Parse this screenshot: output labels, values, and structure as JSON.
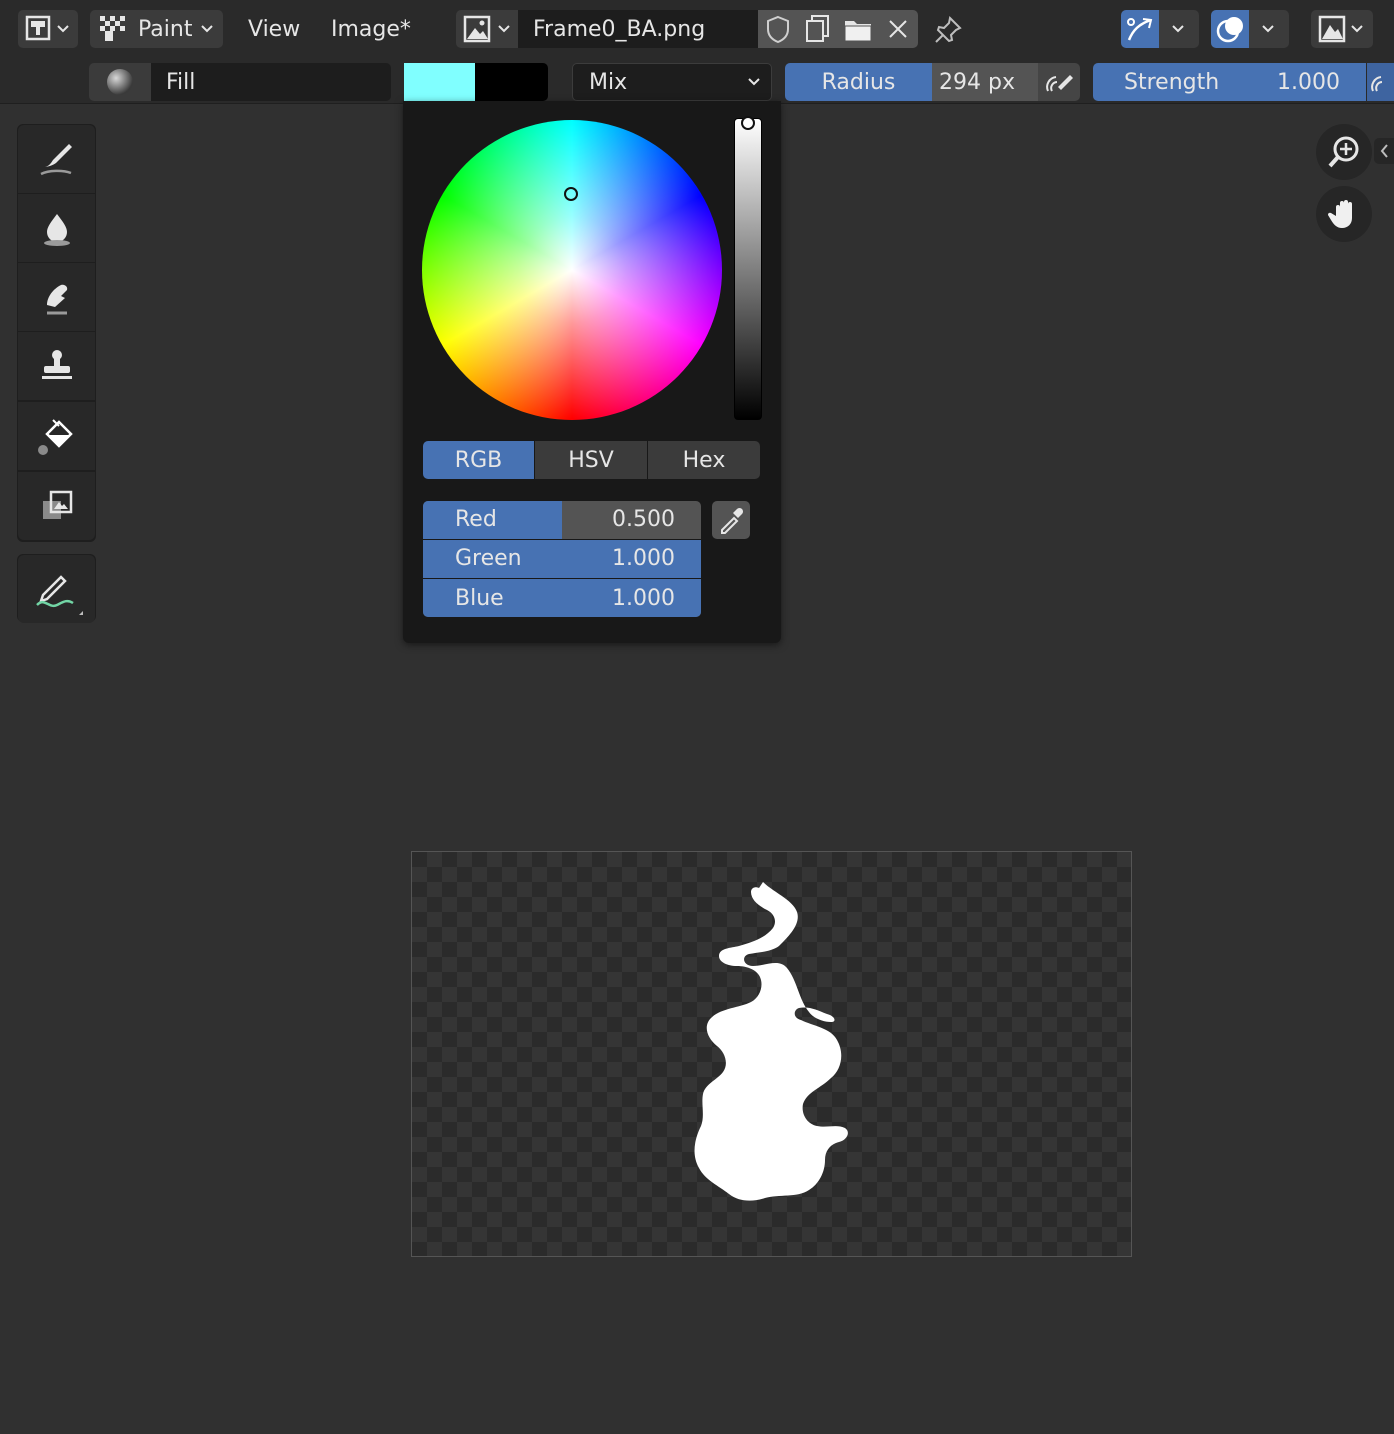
{
  "header": {
    "mode_menu": "Paint",
    "menus": [
      "View",
      "Image*"
    ],
    "image_name": "Frame0_BA.png"
  },
  "toolbar": {
    "brush_name": "Fill",
    "primary_color": "#80ffff",
    "secondary_color": "#000000",
    "blend_mode": "Mix",
    "radius_label": "Radius",
    "radius_value": "294 px",
    "strength_label": "Strength",
    "strength_value": "1.000"
  },
  "color_picker": {
    "modes": [
      "RGB",
      "HSV",
      "Hex"
    ],
    "active_mode": "RGB",
    "channels": [
      {
        "label": "Red",
        "value": "0.500",
        "fraction": 0.5
      },
      {
        "label": "Green",
        "value": "1.000",
        "fraction": 1.0
      },
      {
        "label": "Blue",
        "value": "1.000",
        "fraction": 1.0
      }
    ]
  },
  "tools": [
    "brush",
    "soften",
    "smear",
    "clone",
    "fill",
    "mask",
    "annotate"
  ],
  "active_tool": "fill",
  "colors": {
    "accent": "#4772b3",
    "panel": "#2a2a2a",
    "background": "#303030"
  }
}
